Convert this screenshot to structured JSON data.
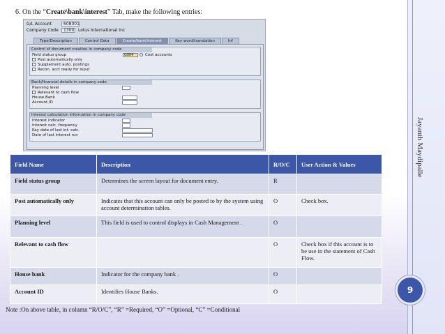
{
  "heading": {
    "prefix": "6. On the “",
    "tab_name": "Create\\bank\\interest",
    "suffix": "” Tab, make the following entries:"
  },
  "sap": {
    "gl_account_label": "G/L Account",
    "gl_account_value": "608001",
    "company_code_label": "Company Code",
    "company_code_value": "1300",
    "company_name": "Lotus International Inc",
    "tabs": [
      "Type/Description",
      "Control Data",
      "Create/bank/interest",
      "Key word/translation",
      "Inf"
    ],
    "group1_title": "Control of document creation in company code",
    "field_status_group_label": "Field status group",
    "field_status_group_value": "G004",
    "field_status_group_desc": "Cost accounts",
    "post_auto_label": "Post automatically only",
    "supplement_label": "Supplement auto. postings",
    "recon_label": "Recon. acct ready for input",
    "group2_title": "Bank/financial details in company code",
    "planning_level_label": "Planning level",
    "relevant_cash_label": "Relevant to cash flow",
    "house_bank_label": "House Bank",
    "account_id_label": "Account ID",
    "group3_title": "Interest calculation information in company code",
    "interest_indicator_label": "Interest indicator",
    "interest_freq_label": "Interest calc. frequency",
    "key_date_label": "Key date of last int. calc.",
    "date_last_run_label": "Date of last interest run"
  },
  "table": {
    "headers": [
      "Field Name",
      "Description",
      "R/O/C",
      "User Action & Values"
    ],
    "rows": [
      [
        "Field status group",
        "Determines the screen layout for document entry.",
        "R",
        ""
      ],
      [
        "Post automatically only",
        "Indicates that this account can only be posted to by the system using account determination tables.",
        "O",
        "Check box."
      ],
      [
        "Planning level",
        "This field is used to control displays in Cash Management .",
        "O",
        ""
      ],
      [
        "Relevant to cash flow",
        "",
        "O",
        "Check box if this account is to be use in the statement of Cash Flow."
      ],
      [
        "House bank",
        "Indicator for the company bank .",
        "O",
        ""
      ],
      [
        "Account ID",
        "Identifies House Banks.",
        "O",
        ""
      ]
    ]
  },
  "note": "Note :On above table, in column “R/O/C”, “R” =Required, “O” =Optional, “C” =Conditional",
  "side_author": "Jayanth Maydipalle",
  "page_number": "9",
  "colors": {
    "accent": "#3d57a8",
    "row_odd": "#d6d9ea",
    "row_even": "#ecedf5"
  }
}
